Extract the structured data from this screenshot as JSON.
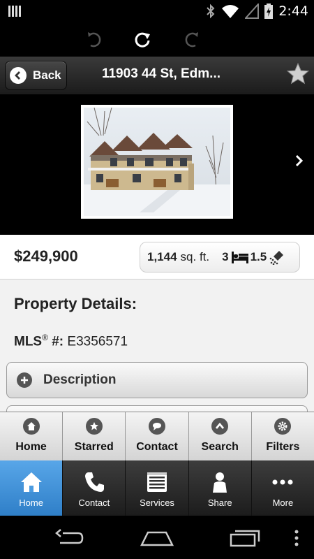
{
  "status_bar": {
    "time": "2:44"
  },
  "header": {
    "back_label": "Back",
    "title": "11903 44 St, Edm..."
  },
  "listing": {
    "price": "$249,900",
    "sqft": "1,144",
    "sqft_unit": "sq. ft.",
    "beds": "3",
    "baths": "1.5"
  },
  "details": {
    "section_title": "Property Details:",
    "mls_key": "MLS",
    "mls_sup": "®",
    "mls_hash": " #:",
    "mls_value": " E3356571",
    "description_label": "Description"
  },
  "app_nav": [
    {
      "label": "Home",
      "icon": "home-icon"
    },
    {
      "label": "Starred",
      "icon": "star-icon"
    },
    {
      "label": "Contact",
      "icon": "chat-icon"
    },
    {
      "label": "Search",
      "icon": "chevron-up-icon"
    },
    {
      "label": "Filters",
      "icon": "gear-icon"
    }
  ],
  "tab_bar": [
    {
      "label": "Home",
      "icon": "home-icon",
      "active": true
    },
    {
      "label": "Contact",
      "icon": "phone-icon"
    },
    {
      "label": "Services",
      "icon": "list-icon"
    },
    {
      "label": "Share",
      "icon": "person-icon"
    },
    {
      "label": "More",
      "icon": "more-icon"
    }
  ],
  "colors": {
    "active_tab": "#3f93dc",
    "header": "#262626"
  }
}
